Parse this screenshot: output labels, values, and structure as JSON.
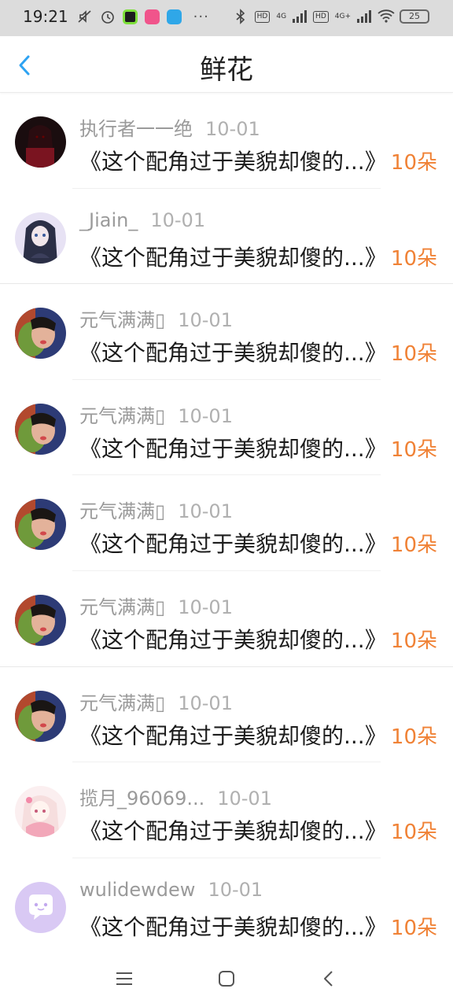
{
  "status_bar": {
    "time": "19:21",
    "network_1": "4G",
    "network_2": "4G+",
    "battery": "25",
    "more": "···"
  },
  "navbar": {
    "title": "鲜花"
  },
  "list": [
    {
      "name": "执行者一一绝",
      "date": "10-01",
      "title": "《这个配角过于美貌却傻的...》",
      "count": "10朵",
      "avatar": "gothic-girl-avatar"
    },
    {
      "name": "_Jiain_",
      "date": "10-01",
      "title": "《这个配角过于美貌却傻的...》",
      "count": "10朵",
      "avatar": "anime-girl-avatar"
    },
    {
      "name": "元气满满▯",
      "date": "10-01",
      "title": "《这个配角过于美貌却傻的...》",
      "count": "10朵",
      "avatar": "selfie-avatar"
    },
    {
      "name": "元气满满▯",
      "date": "10-01",
      "title": "《这个配角过于美貌却傻的...》",
      "count": "10朵",
      "avatar": "selfie-avatar"
    },
    {
      "name": "元气满满▯",
      "date": "10-01",
      "title": "《这个配角过于美貌却傻的...》",
      "count": "10朵",
      "avatar": "selfie-avatar"
    },
    {
      "name": "元气满满▯",
      "date": "10-01",
      "title": "《这个配角过于美貌却傻的...》",
      "count": "10朵",
      "avatar": "selfie-avatar"
    },
    {
      "name": "元气满满▯",
      "date": "10-01",
      "title": "《这个配角过于美貌却傻的...》",
      "count": "10朵",
      "avatar": "selfie-avatar"
    },
    {
      "name": "揽月_96069...",
      "date": "10-01",
      "title": "《这个配角过于美貌却傻的...》",
      "count": "10朵",
      "avatar": "pink-anime-avatar"
    },
    {
      "name": "wulidewdew",
      "date": "10-01",
      "title": "《这个配角过于美貌却傻的...》",
      "count": "10朵",
      "avatar": "default-chat-avatar"
    }
  ],
  "colors": {
    "accent": "#2ea3f2",
    "count": "#f08236"
  }
}
